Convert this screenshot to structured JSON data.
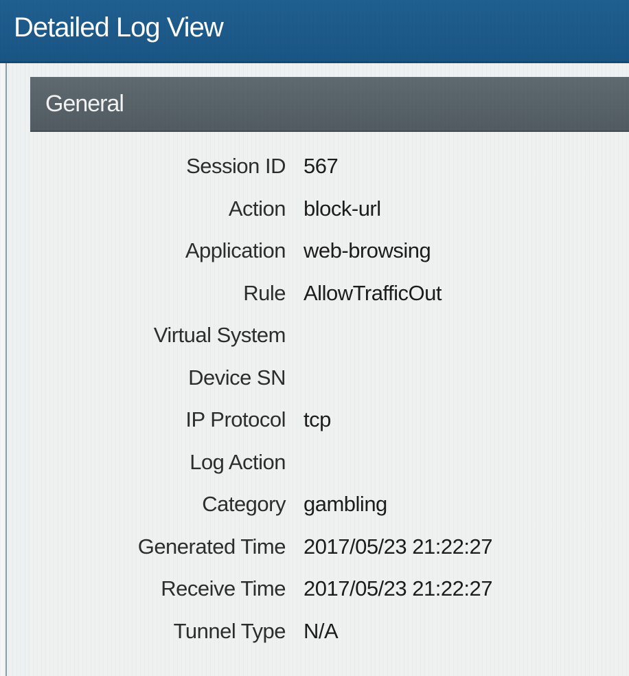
{
  "window": {
    "title": "Detailed Log View"
  },
  "section": {
    "title": "General"
  },
  "fields": [
    {
      "label": "Session ID",
      "value": "567"
    },
    {
      "label": "Action",
      "value": "block-url"
    },
    {
      "label": "Application",
      "value": "web-browsing"
    },
    {
      "label": "Rule",
      "value": "AllowTrafficOut"
    },
    {
      "label": "Virtual System",
      "value": ""
    },
    {
      "label": "Device SN",
      "value": ""
    },
    {
      "label": "IP Protocol",
      "value": "tcp"
    },
    {
      "label": "Log Action",
      "value": ""
    },
    {
      "label": "Category",
      "value": "gambling"
    },
    {
      "label": "Generated Time",
      "value": "2017/05/23 21:22:27"
    },
    {
      "label": "Receive Time",
      "value": "2017/05/23 21:22:27"
    },
    {
      "label": "Tunnel Type",
      "value": "N/A"
    }
  ],
  "colors": {
    "titlebar": "#1f5f90",
    "section_header": "#5f6a70",
    "background": "#eef1f0"
  }
}
